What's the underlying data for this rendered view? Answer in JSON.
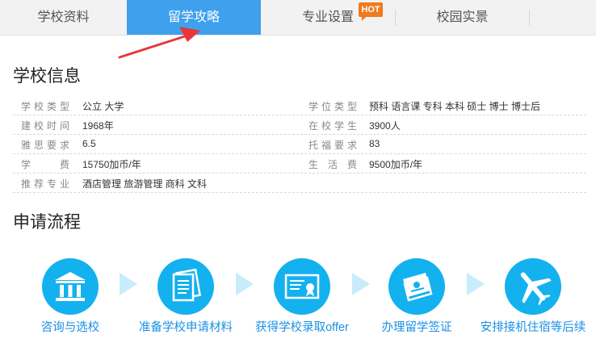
{
  "tabs": [
    {
      "label": "学校资料",
      "active": false
    },
    {
      "label": "留学攻略",
      "active": true
    },
    {
      "label": "专业设置",
      "active": false,
      "badge": "HOT"
    },
    {
      "label": "校园实景",
      "active": false
    }
  ],
  "colors": {
    "accent": "#3fa0ee",
    "hot": "#f07a1e",
    "step_circle": "#14b1ef",
    "step_text": "#1a8fe6",
    "pointer_arrow": "#e8363a"
  },
  "school_info": {
    "title": "学校信息",
    "rows": [
      {
        "l1": "学校类型",
        "v1": "公立 大学",
        "l2": "学位类型",
        "v2": "预科 语言课 专科 本科 硕士 博士 博士后"
      },
      {
        "l1": "建校时间",
        "v1": "1968年",
        "l2": "在校学生",
        "v2": "3900人"
      },
      {
        "l1": "雅思要求",
        "v1": "6.5",
        "l2": "托福要求",
        "v2": "83"
      },
      {
        "l1": "学　　费",
        "v1": "15750加币/年",
        "l2": "生 活 费",
        "v2": "9500加币/年"
      },
      {
        "l1": "推荐专业",
        "v1": "酒店管理 旅游管理 商科 文科",
        "l2": "",
        "v2": ""
      }
    ]
  },
  "process": {
    "title": "申请流程",
    "steps": [
      {
        "label": "咨询与选校",
        "icon": "institution-icon"
      },
      {
        "label": "准备学校申请材料",
        "icon": "documents-icon"
      },
      {
        "label": "获得学校录取offer",
        "icon": "certificate-icon"
      },
      {
        "label": "办理留学签证",
        "icon": "passport-icon"
      },
      {
        "label": "安排接机住宿等后续",
        "icon": "airplane-icon"
      }
    ]
  }
}
